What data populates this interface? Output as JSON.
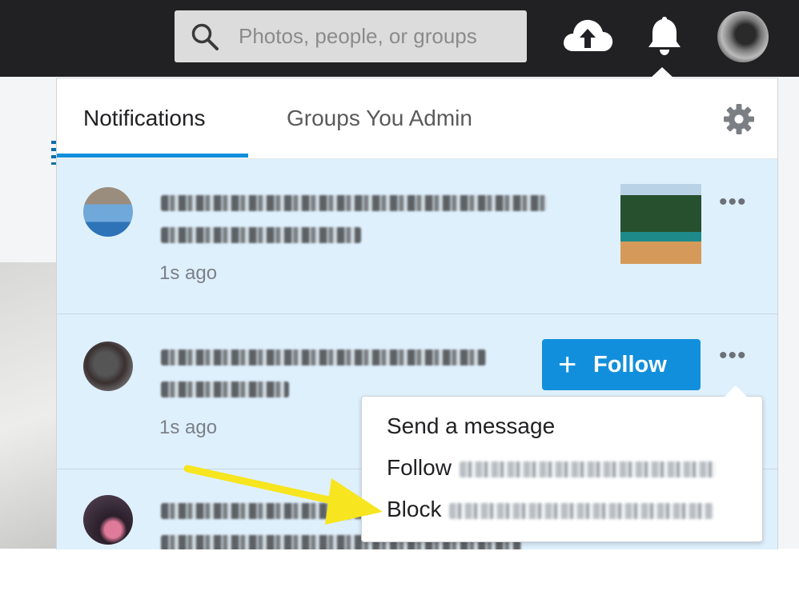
{
  "topbar": {
    "search_placeholder": "Photos, people, or groups",
    "icons": [
      "search-icon",
      "cloud-upload-icon",
      "bell-icon",
      "avatar"
    ]
  },
  "panel": {
    "tabs": [
      {
        "label": "Notifications",
        "active": true
      },
      {
        "label": "Groups You Admin",
        "active": false
      }
    ],
    "settings_icon": "gear-icon",
    "accent_color": "#128fdc",
    "unread_bg": "#dff0fd"
  },
  "notifications": [
    {
      "time": "1s ago",
      "has_thumbnail": true
    },
    {
      "time": "1s ago",
      "follow_label": "Follow"
    },
    {
      "time": ""
    }
  ],
  "menu": {
    "items": [
      {
        "label": "Send a message"
      },
      {
        "label": "Follow"
      },
      {
        "label": "Block"
      }
    ]
  }
}
